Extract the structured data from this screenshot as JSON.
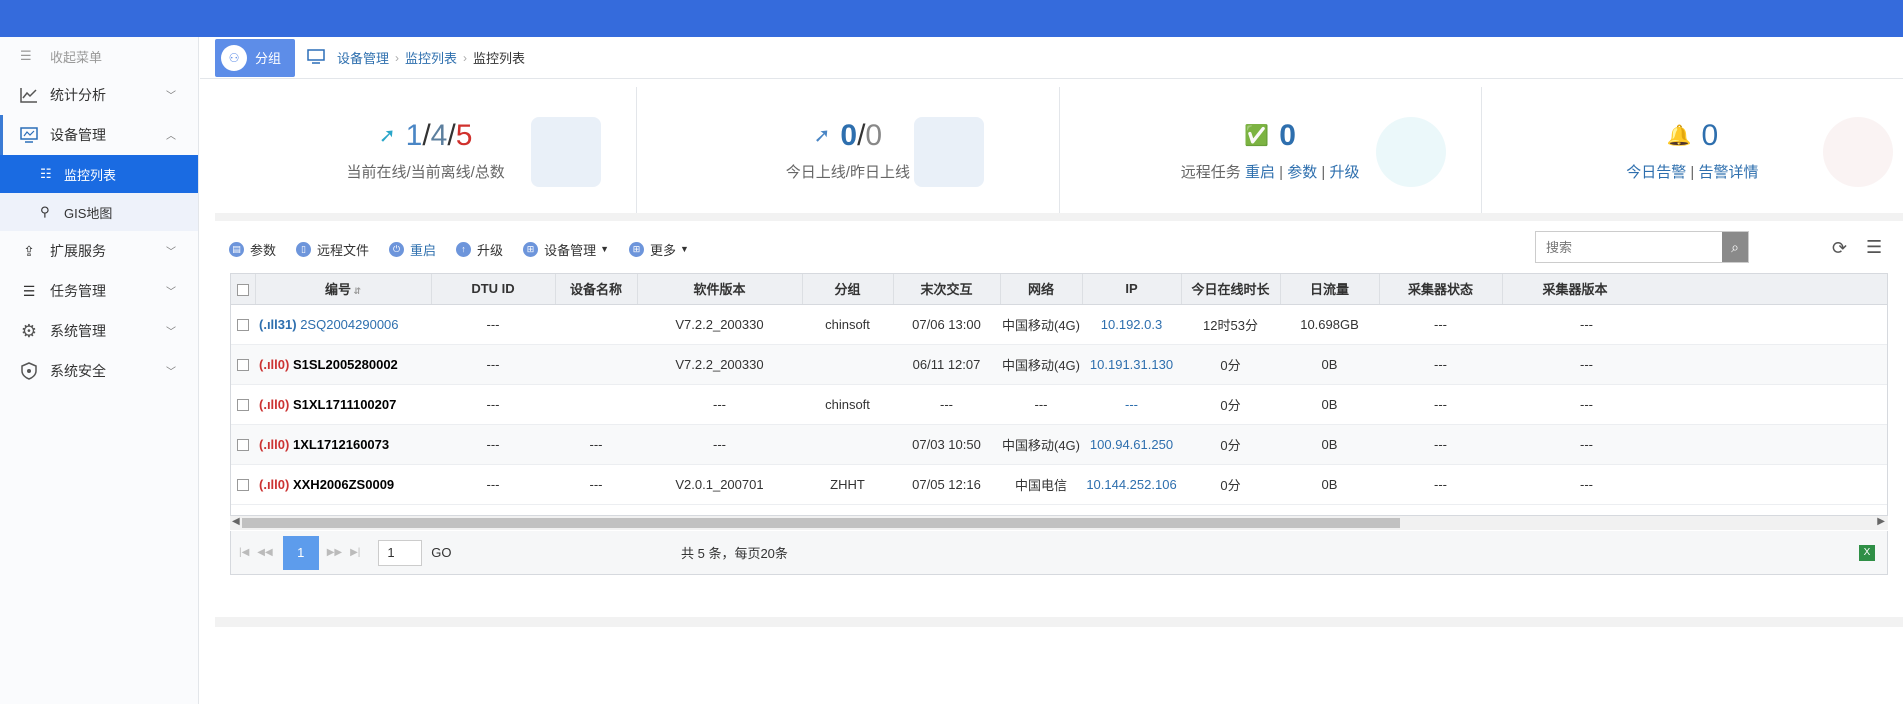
{
  "sidebar": {
    "collapse_label": "收起菜单",
    "items": [
      {
        "label": "统计分析"
      },
      {
        "label": "设备管理"
      },
      {
        "label": "扩展服务"
      },
      {
        "label": "任务管理"
      },
      {
        "label": "系统管理"
      },
      {
        "label": "系统安全"
      }
    ],
    "sub_items": [
      {
        "label": "监控列表"
      },
      {
        "label": "GIS地图"
      }
    ]
  },
  "breadcrumb": {
    "group_label": "分组",
    "items": [
      "设备管理",
      "监控列表",
      "监控列表"
    ]
  },
  "stats": {
    "online": "1",
    "offline": "4",
    "total": "5",
    "online_caption": "当前在线/当前离线/总数",
    "today_online": "0",
    "yesterday_online": "0",
    "today_caption": "今日上线/昨日上线",
    "tasks": "0",
    "tasks_caption": "远程任务",
    "tasks_restart": "重启",
    "tasks_param": "参数",
    "tasks_upgrade": "升级",
    "alarms": "0",
    "alarm_today": "今日告警",
    "alarm_detail": "告警详情"
  },
  "toolbar": {
    "params": "参数",
    "remote_file": "远程文件",
    "restart": "重启",
    "upgrade": "升级",
    "device_mgmt": "设备管理",
    "more": "更多",
    "search_placeholder": "搜索"
  },
  "table": {
    "headers": [
      "编号",
      "DTU ID",
      "设备名称",
      "软件版本",
      "分组",
      "末次交互",
      "网络",
      "IP",
      "今日在线时长",
      "日流量",
      "采集器状态",
      "采集器版本"
    ],
    "rows": [
      {
        "signal": "(.ıll31)",
        "id": "2SQ2004290006",
        "dtu": "---",
        "name": "",
        "version": "V7.2.2_200330",
        "group": "chinsoft",
        "last": "07/06 13:00",
        "net": "中国移动(4G)",
        "ip": "10.192.0.3",
        "online": "12时53分",
        "flow": "10.698GB",
        "cstatus": "---",
        "cversion": "---"
      },
      {
        "signal": "(.ıll0)",
        "id": "S1SL2005280002",
        "dtu": "---",
        "name": "",
        "version": "V7.2.2_200330",
        "group": "",
        "last": "06/11 12:07",
        "net": "中国移动(4G)",
        "ip": "10.191.31.130",
        "online": "0分",
        "flow": "0B",
        "cstatus": "---",
        "cversion": "---"
      },
      {
        "signal": "(.ıll0)",
        "id": "S1XL1711100207",
        "dtu": "---",
        "name": "",
        "version": "---",
        "group": "chinsoft",
        "last": "---",
        "net": "---",
        "ip": "---",
        "online": "0分",
        "flow": "0B",
        "cstatus": "---",
        "cversion": "---"
      },
      {
        "signal": "(.ıll0)",
        "id": "1XL1712160073",
        "dtu": "---",
        "name": "---",
        "version": "---",
        "group": "",
        "last": "07/03 10:50",
        "net": "中国移动(4G)",
        "ip": "100.94.61.250",
        "online": "0分",
        "flow": "0B",
        "cstatus": "---",
        "cversion": "---"
      },
      {
        "signal": "(.ıll0)",
        "id": "XXH2006ZS0009",
        "dtu": "---",
        "name": "---",
        "version": "V2.0.1_200701",
        "group": "ZHHT",
        "last": "07/05 12:16",
        "net": "中国电信",
        "ip": "10.144.252.106",
        "online": "0分",
        "flow": "0B",
        "cstatus": "---",
        "cversion": "---"
      }
    ]
  },
  "pager": {
    "current": "1",
    "input": "1",
    "go": "GO",
    "info": "共 5 条，每页20条"
  }
}
